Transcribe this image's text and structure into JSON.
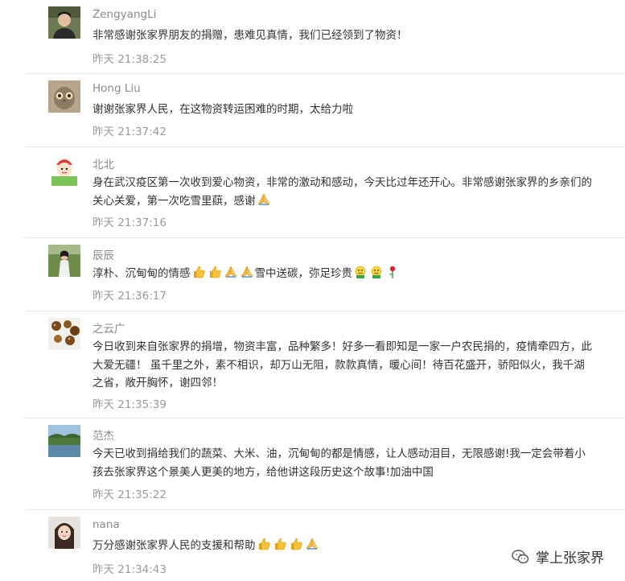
{
  "comments": [
    {
      "name": "ZengyangLi",
      "text": "非常感谢张家界朋友的捐赠，患难见真情，我们已经领到了物资！",
      "time": "昨天 21:38:25",
      "avatar": "man-avatar"
    },
    {
      "name": "Hong Liu",
      "text": "谢谢张家界人民，在这物资转运困难的时期，太给力啦",
      "time": "昨天 21:37:42",
      "avatar": "owl-avatar"
    },
    {
      "name": "北北",
      "text": "身在武汉疫区第一次收到爱心物资，非常的激动和感动，今天比过年还开心。非常感谢张家界的乡亲们的关心关爱，第一次吃雪里蕻，感谢",
      "time": "昨天 21:37:16",
      "avatar": "cartoon-avatar"
    },
    {
      "name": "辰辰",
      "text_a": "淳朴、沉甸甸的情感",
      "text_b": "雪中送碳，弥足珍贵",
      "time": "昨天 21:36:17",
      "avatar": "girl-outdoor-avatar"
    },
    {
      "name": "之云广",
      "text": "今日收到来自张家界的捐增，物资丰富，品种繁多！好多一看即知是一家一户农民捐的，疫情牵四方，此大爱无疆！ 虽千里之外，素不相识，却万山无阻，款款真情，暖心间！待百花盛开，骄阳似火，我千湖之省，敞开胸怀，谢四邻！",
      "time": "昨天 21:35:39",
      "avatar": "beads-avatar"
    },
    {
      "name": "范杰",
      "text": "今天已收到捐给我们的蔬菜、大米、油，沉甸甸的都是情感，让人感动泪目，无限感谢!我一定会带着小孩去张家界这个景美人更美的地方，给他讲这段历史这个故事!加油中国",
      "time": "昨天 21:35:22",
      "avatar": "lake-avatar"
    },
    {
      "name": "nana",
      "text": "万分感谢张家界人民的支援和帮助",
      "time": "昨天 21:34:43",
      "avatar": "woman-avatar"
    }
  ],
  "watermark": {
    "label": "掌上张家界",
    "icon": "wechat-icon"
  },
  "colors": {
    "nick": "#8a8a8a",
    "text": "#333333",
    "time": "#9a9a9a",
    "divider": "#e6e6e6"
  }
}
